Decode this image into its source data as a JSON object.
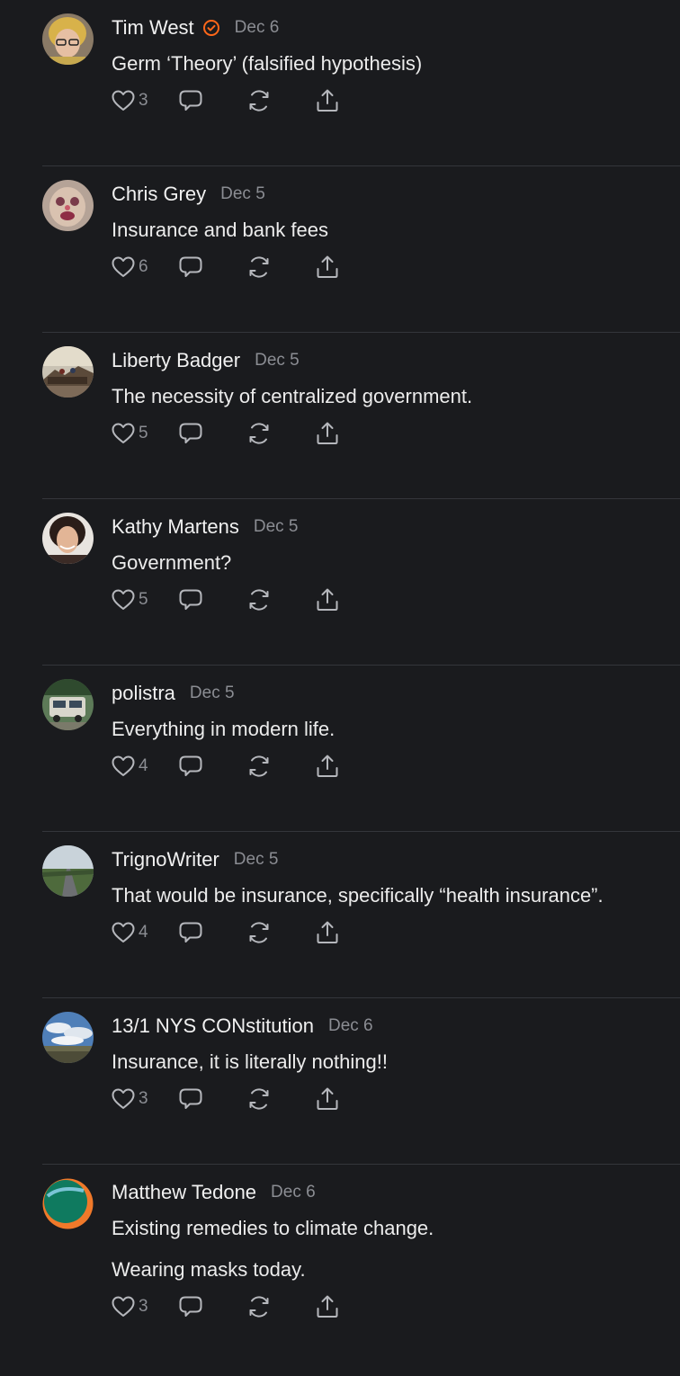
{
  "colors": {
    "background": "#1a1b1e",
    "divider": "#34363b",
    "text": "#ececec",
    "muted": "#8b8d93",
    "icon": "#b5b7bc",
    "verified": "#ff6719"
  },
  "comments": [
    {
      "author": "Tim West",
      "verified": true,
      "date": "Dec 6",
      "text": "Germ ‘Theory’ (falsified hypothesis)",
      "likes": "3",
      "avatar": "avatar-blonde-woman-glasses"
    },
    {
      "author": "Chris Grey",
      "verified": false,
      "date": "Dec 5",
      "text": "Insurance and bank fees",
      "likes": "6",
      "avatar": "avatar-painted-face"
    },
    {
      "author": "Liberty Badger",
      "verified": false,
      "date": "Dec 5",
      "text": "The necessity of centralized government.",
      "likes": "5",
      "avatar": "avatar-painting"
    },
    {
      "author": "Kathy Martens",
      "verified": false,
      "date": "Dec 5",
      "text": "Government?",
      "likes": "5",
      "avatar": "avatar-woman-portrait"
    },
    {
      "author": "polistra",
      "verified": false,
      "date": "Dec 5",
      "text": "Everything in modern life.",
      "likes": "4",
      "avatar": "avatar-old-van"
    },
    {
      "author": "TrignoWriter",
      "verified": false,
      "date": "Dec 5",
      "text": "That would be insurance, specifically “health insurance”.",
      "likes": "4",
      "avatar": "avatar-road-landscape"
    },
    {
      "author": "13/1 NYS CONstitution",
      "verified": false,
      "date": "Dec 6",
      "text": "Insurance, it is literally nothing!!",
      "likes": "3",
      "avatar": "avatar-sky-field"
    },
    {
      "author": "Matthew Tedone",
      "verified": false,
      "date": "Dec 6",
      "text": "Existing remedies to climate change.",
      "text2": "Wearing masks today.",
      "likes": "3",
      "avatar": "avatar-green-orange-circle"
    }
  ]
}
